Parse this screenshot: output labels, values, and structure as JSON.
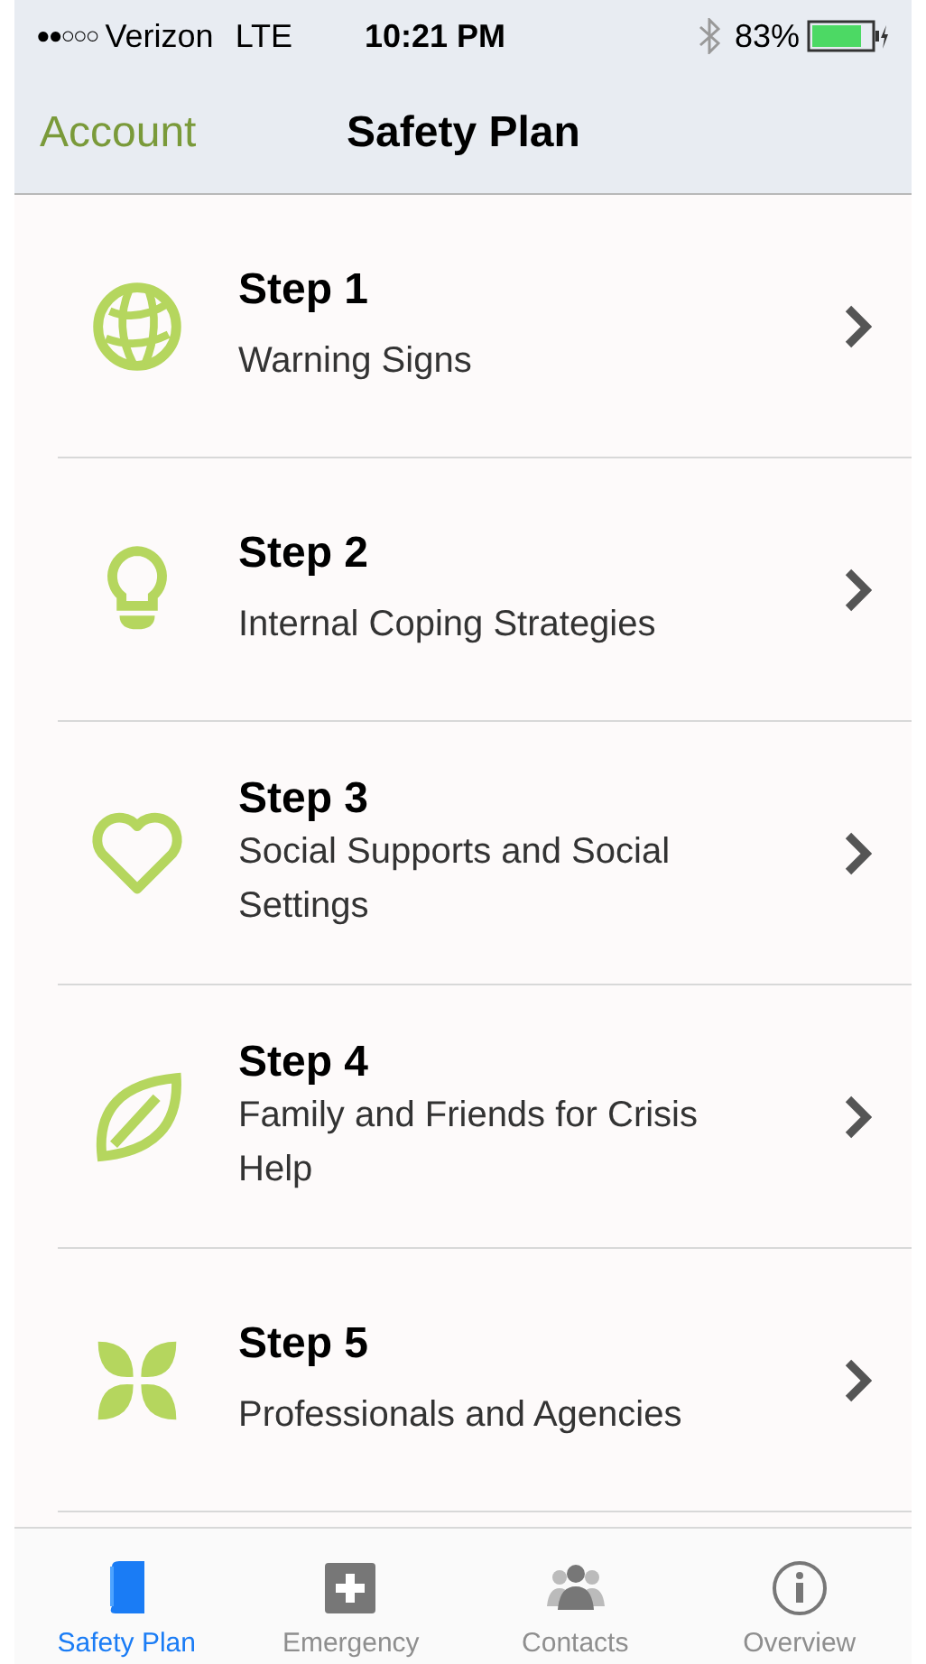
{
  "status_bar": {
    "signal": "●●○○○",
    "carrier": "Verizon",
    "network": "LTE",
    "time": "10:21 PM",
    "battery": "83%"
  },
  "nav_bar": {
    "back": "Account",
    "title": "Safety Plan"
  },
  "steps": [
    {
      "kind": "globe",
      "title": "Step 1",
      "subtitle": "Warning Signs"
    },
    {
      "kind": "bulb",
      "title": "Step 2",
      "subtitle": "Internal Coping Strategies"
    },
    {
      "kind": "heart",
      "title": "Step 3",
      "subtitle": "Social Supports and Social Settings"
    },
    {
      "kind": "leaf",
      "title": "Step 4",
      "subtitle": "Family and Friends for Crisis Help"
    },
    {
      "kind": "petals",
      "title": "Step 5",
      "subtitle": "Professionals and Agencies"
    }
  ],
  "tabs": [
    {
      "kind": "book",
      "label": "Safety Plan",
      "selected": true
    },
    {
      "kind": "plus",
      "label": "Emergency",
      "selected": false
    },
    {
      "kind": "people",
      "label": "Contacts",
      "selected": false
    },
    {
      "kind": "info",
      "label": "Overview",
      "selected": false
    }
  ]
}
